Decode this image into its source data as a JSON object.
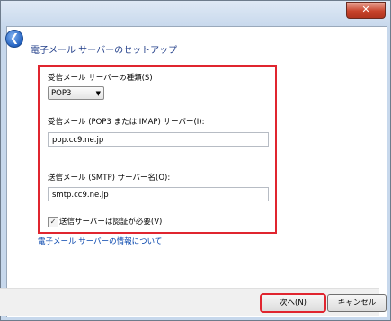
{
  "window": {
    "close_label": "✕"
  },
  "nav": {
    "back_icon": "back-arrow-icon"
  },
  "page": {
    "heading": "電子メール サーバーのセットアップ"
  },
  "form": {
    "server_type_label": "受信メール サーバーの種類(S)",
    "server_type_value": "POP3",
    "incoming_label": "受信メール (POP3 または IMAP) サーバー(I):",
    "incoming_value": "pop.cc9.ne.jp",
    "outgoing_label": "送信メール (SMTP) サーバー名(O):",
    "outgoing_value": "smtp.cc9.ne.jp",
    "auth_label": "送信サーバーは認証が必要(V)",
    "auth_checked": true
  },
  "info_link": "電子メール サーバーの情報について",
  "buttons": {
    "next": "次へ(N)",
    "cancel": "キャンセル"
  },
  "colors": {
    "highlight": "#e0252f",
    "heading": "#1f3c88",
    "link": "#0645ad"
  }
}
